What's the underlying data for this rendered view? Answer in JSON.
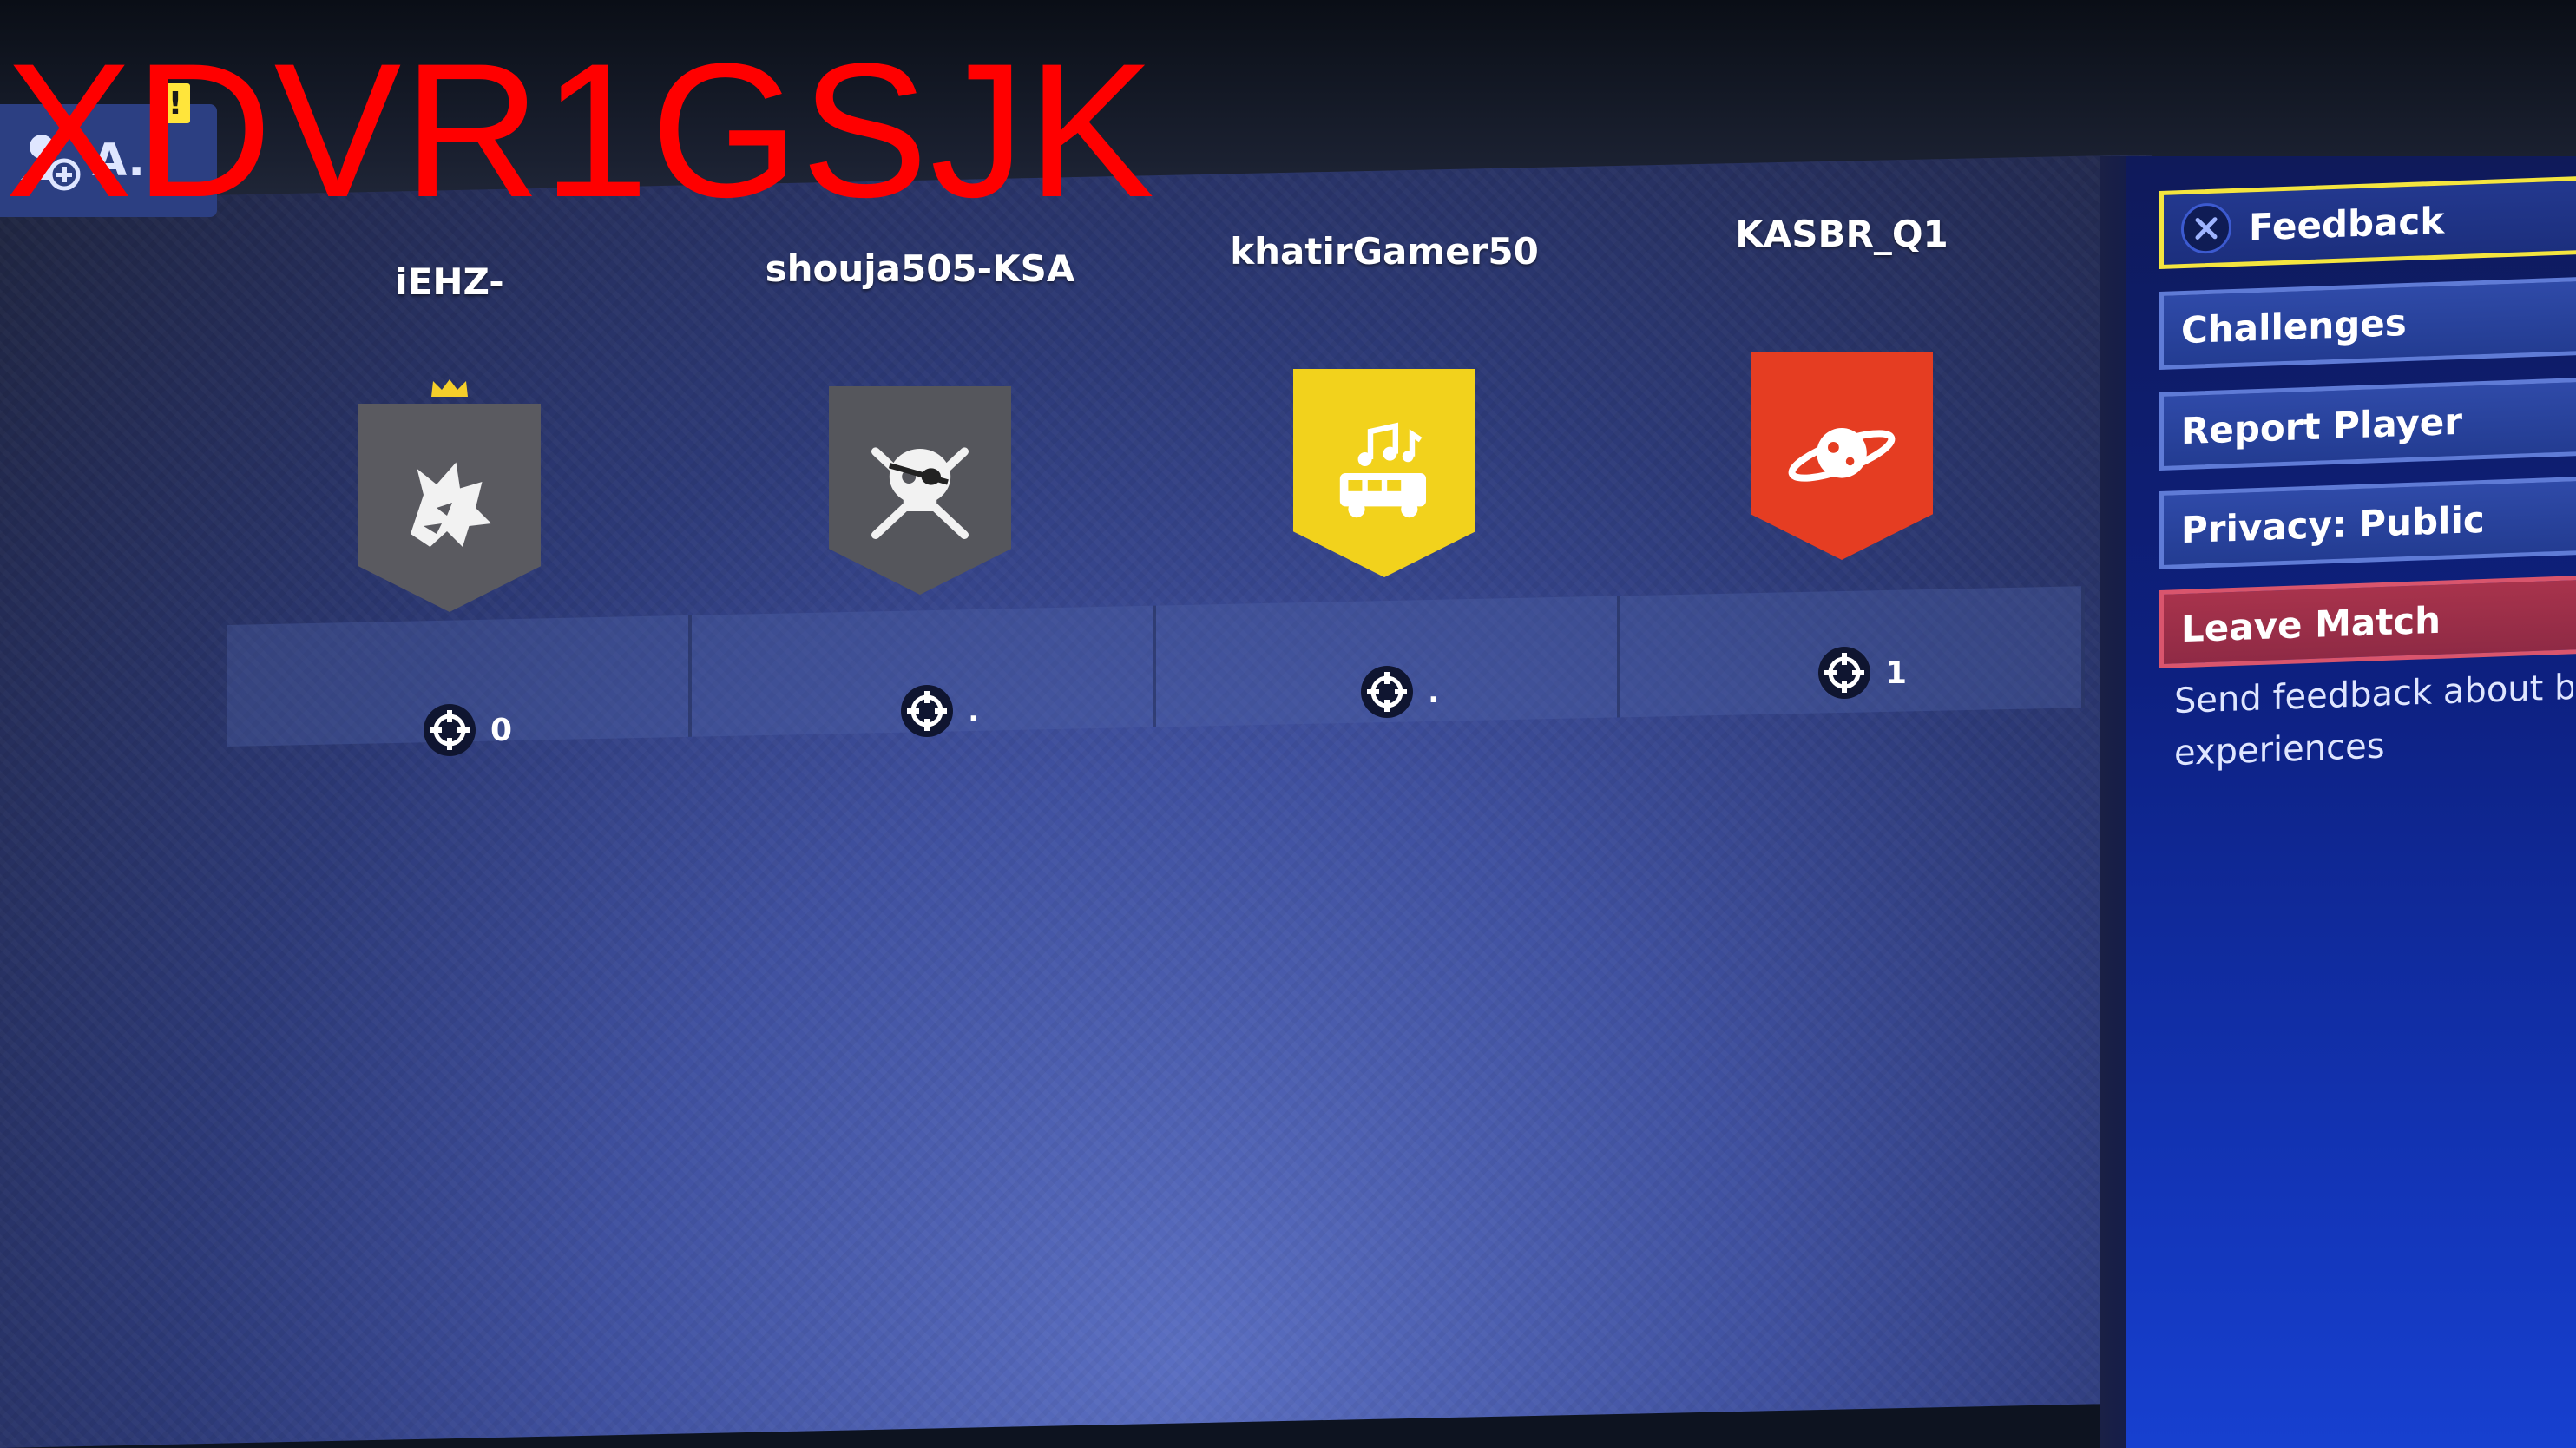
{
  "watermark": "XDVR1GSJK",
  "social": {
    "label": "A.",
    "alert_badge": "!"
  },
  "players": [
    {
      "name": "iEHZ-",
      "banner": "wolf-emblem",
      "banner_color": "#5a5a60",
      "leader": true,
      "stat": "0"
    },
    {
      "name": "shouja505-KSA",
      "banner": "pirate-skull-emblem",
      "banner_color": "#55565c",
      "leader": false,
      "stat": "."
    },
    {
      "name": "khatirGamer50",
      "banner": "battle-bus-emblem",
      "banner_color": "#f2d21c",
      "leader": false,
      "stat": "."
    },
    {
      "name": "KASBR_Q1",
      "banner": "planet-emblem",
      "banner_color": "#e53d22",
      "leader": false,
      "stat": "1"
    }
  ],
  "menu": {
    "feedback": "Feedback",
    "challenges": "Challenges",
    "report_player": "Report Player",
    "privacy": "Privacy: Public",
    "leave_match": "Leave Match",
    "description_line1": "Send feedback about b",
    "description_line2": "experiences"
  },
  "colors": {
    "selected_border": "#f4e53f",
    "danger": "#a8334c",
    "menu_border": "#5f7bd6"
  }
}
